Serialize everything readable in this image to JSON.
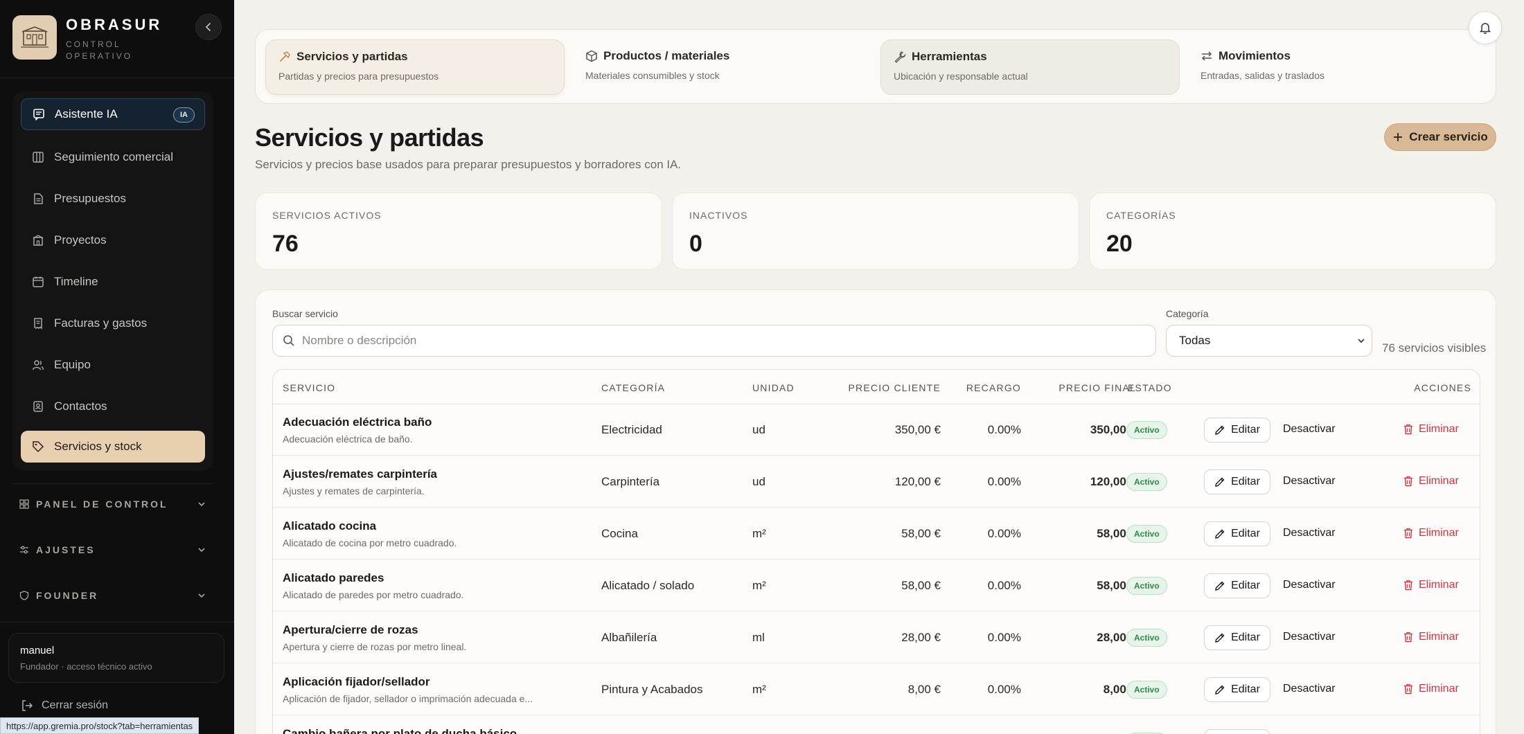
{
  "brand": {
    "name": "OBRASUR",
    "subtitle": "CONTROL OPERATIVO",
    "logo_text": "OBRASUR"
  },
  "sidebar": {
    "items": [
      {
        "label": "Asistente IA",
        "badge": "IA",
        "icon": "chat-icon"
      },
      {
        "label": "Seguimiento comercial",
        "icon": "columns-icon"
      },
      {
        "label": "Presupuestos",
        "icon": "document-icon"
      },
      {
        "label": "Proyectos",
        "icon": "building-icon"
      },
      {
        "label": "Timeline",
        "icon": "calendar-icon"
      },
      {
        "label": "Facturas y gastos",
        "icon": "receipt-icon"
      },
      {
        "label": "Equipo",
        "icon": "users-icon"
      },
      {
        "label": "Contactos",
        "icon": "contact-icon"
      },
      {
        "label": "Servicios y stock",
        "icon": "tag-icon"
      }
    ],
    "sections": [
      {
        "label": "PANEL DE CONTROL",
        "icon": "grid-icon"
      },
      {
        "label": "AJUSTES",
        "icon": "sliders-icon"
      },
      {
        "label": "FOUNDER",
        "icon": "shield-icon"
      }
    ],
    "user": {
      "name": "manuel",
      "role": "Fundador · acceso técnico activo"
    },
    "logout": "Cerrar sesión"
  },
  "status_url": "https://app.gremia.pro/stock?tab=herramientas",
  "tabs": [
    {
      "title": "Servicios y partidas",
      "sub": "Partidas y precios para presupuestos",
      "icon": "hammer-icon"
    },
    {
      "title": "Productos / materiales",
      "sub": "Materiales consumibles y stock",
      "icon": "package-icon"
    },
    {
      "title": "Herramientas",
      "sub": "Ubicación y responsable actual",
      "icon": "wrench-icon"
    },
    {
      "title": "Movimientos",
      "sub": "Entradas, salidas y traslados",
      "icon": "arrows-icon"
    }
  ],
  "page": {
    "title": "Servicios y partidas",
    "subtitle": "Servicios y precios base usados para preparar presupuestos y borradores con IA.",
    "create_label": "Crear servicio"
  },
  "stats": [
    {
      "label": "SERVICIOS ACTIVOS",
      "value": "76"
    },
    {
      "label": "INACTIVOS",
      "value": "0"
    },
    {
      "label": "CATEGORÍAS",
      "value": "20"
    }
  ],
  "filters": {
    "search_label": "Buscar servicio",
    "search_placeholder": "Nombre o descripción",
    "category_label": "Categoría",
    "category_value": "Todas",
    "visible_count": "76 servicios visibles"
  },
  "table": {
    "headers": [
      "SERVICIO",
      "CATEGORÍA",
      "UNIDAD",
      "PRECIO CLIENTE",
      "RECARGO",
      "PRECIO FINAL",
      "ESTADO",
      "ACCIONES"
    ],
    "edit_label": "Editar",
    "deactivate_label": "Desactivar",
    "delete_label": "Eliminar",
    "rows": [
      {
        "name": "Adecuación eléctrica baño",
        "desc": "Adecuación eléctrica de baño.",
        "category": "Electricidad",
        "unit": "ud",
        "price": "350,00 €",
        "surcharge": "0.00%",
        "final": "350,00 €",
        "status": "Activo"
      },
      {
        "name": "Ajustes/remates carpintería",
        "desc": "Ajustes y remates de carpintería.",
        "category": "Carpintería",
        "unit": "ud",
        "price": "120,00 €",
        "surcharge": "0.00%",
        "final": "120,00 €",
        "status": "Activo"
      },
      {
        "name": "Alicatado cocina",
        "desc": "Alicatado de cocina por metro cuadrado.",
        "category": "Cocina",
        "unit": "m²",
        "price": "58,00 €",
        "surcharge": "0.00%",
        "final": "58,00 €",
        "status": "Activo"
      },
      {
        "name": "Alicatado paredes",
        "desc": "Alicatado de paredes por metro cuadrado.",
        "category": "Alicatado / solado",
        "unit": "m²",
        "price": "58,00 €",
        "surcharge": "0.00%",
        "final": "58,00 €",
        "status": "Activo"
      },
      {
        "name": "Apertura/cierre de rozas",
        "desc": "Apertura y cierre de rozas por metro lineal.",
        "category": "Albañilería",
        "unit": "ml",
        "price": "28,00 €",
        "surcharge": "0.00%",
        "final": "28,00 €",
        "status": "Activo"
      },
      {
        "name": "Aplicación fijador/sellador",
        "desc": "Aplicación de fijador, sellador o imprimación adecuada e...",
        "category": "Pintura y Acabados",
        "unit": "m²",
        "price": "8,00 €",
        "surcharge": "0.00%",
        "final": "8,00 €",
        "status": "Activo"
      },
      {
        "name": "Cambio bañera por plato de ducha básico",
        "desc": "",
        "category": "",
        "unit": "",
        "price": "",
        "surcharge": "",
        "final": "",
        "status": "Activo"
      }
    ]
  },
  "colors": {
    "sidebar_bg": "#0e0e0e",
    "accent": "#d9b995",
    "active_nav": "#e8cfb0",
    "danger": "#d2343f",
    "success": "#2f8a4a"
  }
}
